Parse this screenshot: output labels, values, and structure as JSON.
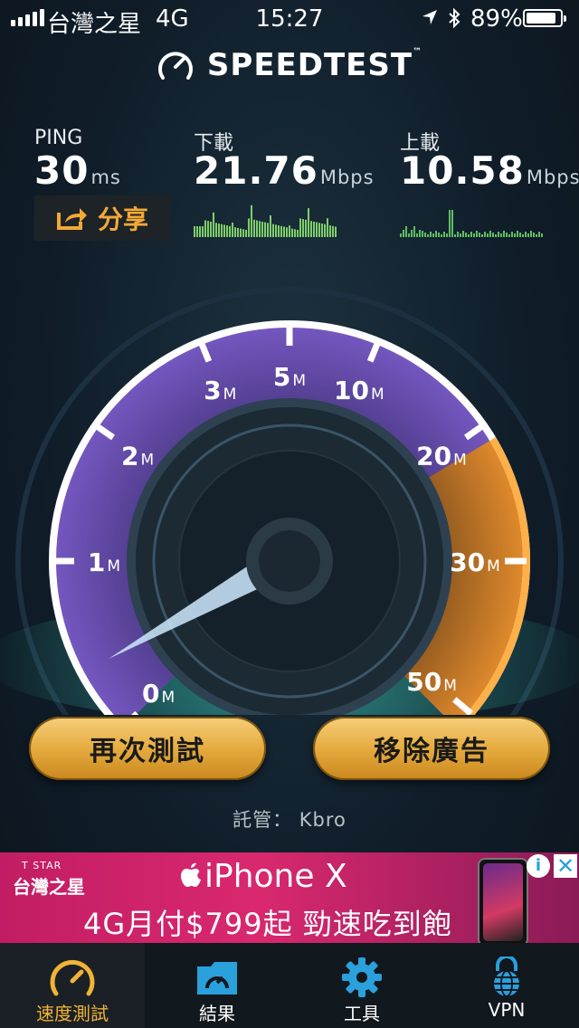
{
  "status_bar": {
    "carrier": "台灣之星",
    "network": "4G",
    "time": "15:27",
    "battery": "89%",
    "battery_level": 0.89
  },
  "app": {
    "logo": "SPEEDTEST",
    "logo_tm": "™"
  },
  "metrics": {
    "ping": {
      "label": "PING",
      "value": "30",
      "unit": "ms"
    },
    "download": {
      "label": "下載",
      "value": "21.76",
      "unit": "Mbps"
    },
    "upload": {
      "label": "上載",
      "value": "10.58",
      "unit": "Mbps"
    }
  },
  "share_button": {
    "label": "分享"
  },
  "gauge": {
    "ticks": [
      {
        "value": "0",
        "unit": "M"
      },
      {
        "value": "1",
        "unit": "M"
      },
      {
        "value": "2",
        "unit": "M"
      },
      {
        "value": "3",
        "unit": "M"
      },
      {
        "value": "5",
        "unit": "M"
      },
      {
        "value": "10",
        "unit": "M"
      },
      {
        "value": "20",
        "unit": "M"
      },
      {
        "value": "30",
        "unit": "M"
      },
      {
        "value": "50",
        "unit": "M"
      }
    ],
    "needle_value": "0"
  },
  "buttons": {
    "retest": "再次測試",
    "remove_ads": "移除廣告"
  },
  "hosted": {
    "label": "託管：",
    "provider": "Kbro"
  },
  "ad": {
    "brand_top": "T STAR",
    "brand": "台灣之星",
    "title": "iPhone X",
    "subtitle": "4G月付$799起  勁速吃到飽",
    "info": "i",
    "close": "✕"
  },
  "tabs": [
    {
      "label": "速度測試",
      "active": true
    },
    {
      "label": "結果",
      "active": false
    },
    {
      "label": "工具",
      "active": false
    },
    {
      "label": "VPN",
      "active": false
    }
  ],
  "colors": {
    "accent": "#f1b337",
    "gauge_purple": "#6b4fb0",
    "gauge_orange": "#e08a2c",
    "ad_pink": "#d9286e"
  }
}
